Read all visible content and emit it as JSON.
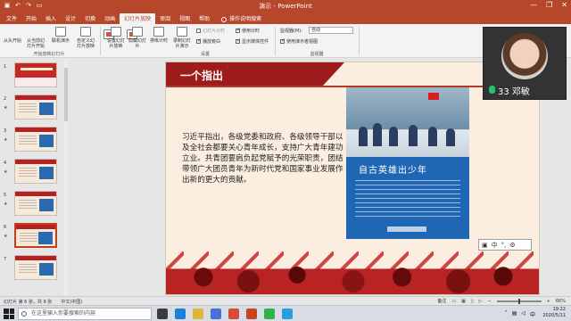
{
  "window": {
    "title": "演示 - PowerPoint",
    "qat_icons": [
      "save-icon",
      "undo-icon",
      "redo-icon",
      "present-icon"
    ],
    "controls": [
      "—",
      "❐",
      "✕"
    ]
  },
  "ribbon": {
    "tabs": [
      "文件",
      "开始",
      "插入",
      "设计",
      "切换",
      "动画",
      "幻灯片放映",
      "审阅",
      "视图",
      "帮助"
    ],
    "active_tab": "幻灯片放映",
    "search_label": "操作说明搜索",
    "groups": {
      "start": {
        "label": "开始放映幻灯片",
        "buttons": [
          "从头开始",
          "从当前幻灯片开始",
          "联机演示",
          "自定义幻灯片放映"
        ]
      },
      "setup": {
        "label": "设置",
        "buttons": [
          "设置幻灯片放映",
          "隐藏幻灯片",
          "排练计时",
          "录制幻灯片演示"
        ],
        "checks": [
          {
            "label": "播放旁白",
            "checked": true
          },
          {
            "label": "使用计时",
            "checked": true
          },
          {
            "label": "显示媒体控件",
            "checked": true
          }
        ],
        "dim_label": "幻灯片计时"
      },
      "monitors": {
        "label": "监视器",
        "monitor_label": "监视器(M):",
        "monitor_value": "自动",
        "presenter_view": "使用演示者视图"
      }
    }
  },
  "thumbnails": [
    {
      "num": "1",
      "type": "cover"
    },
    {
      "num": "2",
      "type": "content"
    },
    {
      "num": "3",
      "type": "content"
    },
    {
      "num": "4",
      "type": "content"
    },
    {
      "num": "5",
      "type": "content"
    },
    {
      "num": "6",
      "type": "content",
      "selected": true
    },
    {
      "num": "7",
      "type": "content"
    }
  ],
  "slide": {
    "heading": "一个指出",
    "body": "习近平指出，各级党委和政府、各级领导干部以及全社会都要关心青年成长，支持广大青年建功立业。共青团要肩负起党赋予的光荣职责，团结带领广大团员青年为新时代党和国家事业发展作出新的更大的贡献。",
    "panel_title": "自古英雄出少年"
  },
  "video": {
    "name": "33 邓敏"
  },
  "ime": {
    "label": "中"
  },
  "statusbar": {
    "slide_count": "幻灯片 第 6 张，共 9 张",
    "language": "中文(中国)",
    "notes": "备注",
    "zoom": "66%"
  },
  "taskbar": {
    "search_placeholder": "在这里输入你要搜索的内容",
    "time": "19:22",
    "date": "2020/5/11",
    "ime_indicator": "中",
    "apps": [
      {
        "name": "task-view-icon",
        "color": "#3c3c3c"
      },
      {
        "name": "edge-icon",
        "color": "#1e7fd6"
      },
      {
        "name": "explorer-icon",
        "color": "#e0b43a"
      },
      {
        "name": "store-icon",
        "color": "#4a6fd6"
      },
      {
        "name": "chrome-icon",
        "color": "#d84a3a"
      },
      {
        "name": "powerpoint-icon",
        "color": "#c4441e"
      },
      {
        "name": "wechat-icon",
        "color": "#2fb24a"
      },
      {
        "name": "qq-icon",
        "color": "#2a9de0"
      }
    ]
  }
}
